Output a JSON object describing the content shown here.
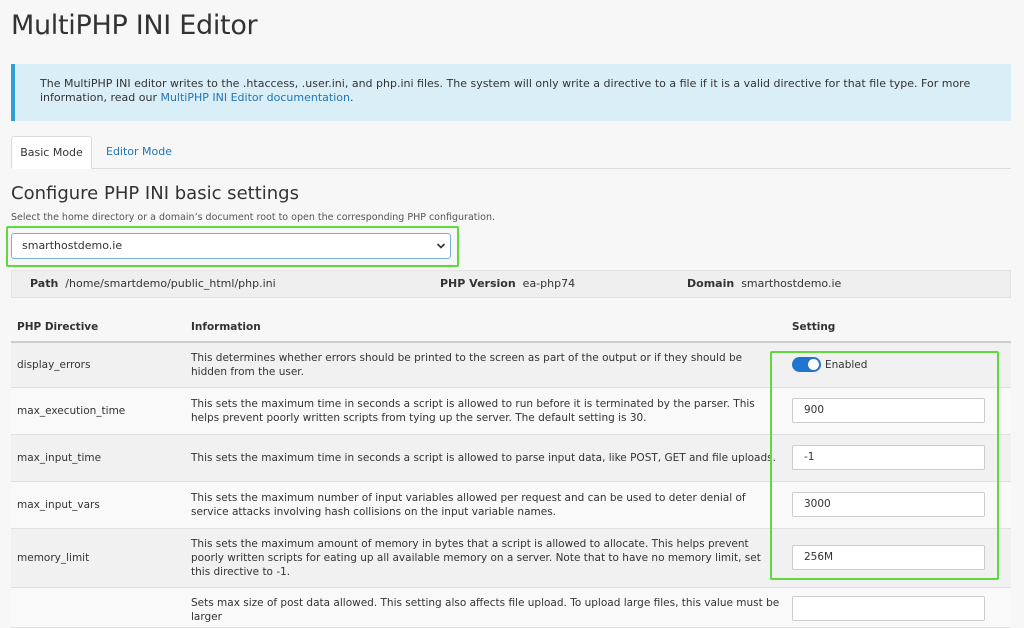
{
  "header": {
    "title": "MultiPHP INI Editor"
  },
  "notice": {
    "text": "The MultiPHP INI editor writes to the .htaccess, .user.ini, and php.ini files. The system will only write a directive to a file if it is a valid directive for that file type. For more information, read our ",
    "link_text": "MultiPHP INI Editor documentation",
    "suffix": "."
  },
  "tabs": [
    {
      "label": "Basic Mode"
    },
    {
      "label": "Editor Mode"
    }
  ],
  "section": {
    "title": "Configure PHP INI basic settings",
    "subtitle": "Select the home directory or a domain’s document root to open the corresponding PHP configuration."
  },
  "domain_select": {
    "value": "smarthostdemo.ie"
  },
  "path_bar": {
    "path_label": "Path",
    "path_value": "/home/smartdemo/public_html/php.ini",
    "version_label": "PHP Version",
    "version_value": "ea-php74",
    "domain_label": "Domain",
    "domain_value": "smarthostdemo.ie"
  },
  "table": {
    "headers": {
      "directive": "PHP Directive",
      "information": "Information",
      "setting": "Setting"
    },
    "rows": [
      {
        "directive": "display_errors",
        "info": "This determines whether errors should be printed to the screen as part of the output or if they should be hidden from the user.",
        "setting": "Enabled"
      },
      {
        "directive": "max_execution_time",
        "info": "This sets the maximum time in seconds a script is allowed to run before it is terminated by the parser. This helps prevent poorly written scripts from tying up the server. The default setting is 30.",
        "setting": "900"
      },
      {
        "directive": "max_input_time",
        "info": "This sets the maximum time in seconds a script is allowed to parse input data, like POST, GET and file uploads.",
        "setting": "-1"
      },
      {
        "directive": "max_input_vars",
        "info": "This sets the maximum number of input variables allowed per request and can be used to deter denial of service attacks involving hash collisions on the input variable names.",
        "setting": "3000"
      },
      {
        "directive": "memory_limit",
        "info": "This sets the maximum amount of memory in bytes that a script is allowed to allocate. This helps prevent poorly written scripts for eating up all available memory on a server. Note that to have no memory limit, set this directive to -1.",
        "setting": "256M"
      },
      {
        "directive": "",
        "info": "Sets max size of post data allowed. This setting also affects file upload. To upload large files, this value must be larger",
        "setting": ""
      }
    ]
  },
  "colors": {
    "highlight": "#5fd93c",
    "accent": "#1f75d0",
    "link": "#1f75b5"
  }
}
